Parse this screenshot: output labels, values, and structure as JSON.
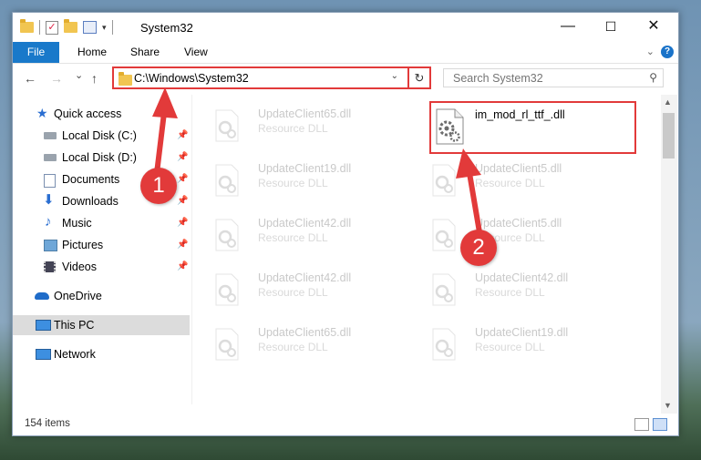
{
  "window": {
    "title": "System32",
    "controls": {
      "minimize": "—",
      "maximize": "☐",
      "close": "✕"
    }
  },
  "ribbon": {
    "tabs": [
      "File",
      "Home",
      "Share",
      "View"
    ],
    "expand_icon": "chevron-down-icon",
    "help_icon": "help-icon"
  },
  "navbar": {
    "back": "←",
    "forward": "→",
    "recent": "⌄",
    "up": "↑",
    "address": "C:\\Windows\\System32",
    "search_placeholder": "Search System32"
  },
  "navigation_pane": {
    "items": [
      {
        "label": "Quick access",
        "icon": "star-icon"
      },
      {
        "label": "Local Disk (C:)",
        "icon": "drive-icon",
        "pinned": true
      },
      {
        "label": "Local Disk (D:)",
        "icon": "drive-icon",
        "pinned": true
      },
      {
        "label": "Documents",
        "icon": "documents-icon",
        "pinned": true
      },
      {
        "label": "Downloads",
        "icon": "downloads-icon",
        "pinned": true
      },
      {
        "label": "Music",
        "icon": "music-icon",
        "pinned": true
      },
      {
        "label": "Pictures",
        "icon": "pictures-icon",
        "pinned": true
      },
      {
        "label": "Videos",
        "icon": "videos-icon",
        "pinned": true
      },
      {
        "label": "OneDrive",
        "icon": "cloud-icon"
      },
      {
        "label": "This PC",
        "icon": "computer-icon",
        "selected": true
      },
      {
        "label": "Network",
        "icon": "network-icon"
      }
    ]
  },
  "files": [
    {
      "name": "UpdateClient65.dll",
      "type": "Resource DLL"
    },
    {
      "name": "UpdateClient19.dll",
      "type": "Resource DLL"
    },
    {
      "name": "UpdateClient42.dll",
      "type": "Resource DLL"
    },
    {
      "name": "UpdateClient42.dll",
      "type": "Resource DLL"
    },
    {
      "name": "UpdateClient65.dll",
      "type": "Resource DLL"
    },
    {
      "name": "UpdateClient5.dll",
      "type": "Resource DLL"
    },
    {
      "name": "UpdateClient5.dll",
      "type": "Resource DLL"
    },
    {
      "name": "UpdateClient42.dll",
      "type": "Resource DLL"
    },
    {
      "name": "UpdateClient19.dll",
      "type": "Resource DLL"
    }
  ],
  "highlighted_file": {
    "name": "im_mod_rl_ttf_.dll"
  },
  "status": {
    "item_count": "154 items"
  },
  "annotations": {
    "step1": "1",
    "step2": "2"
  },
  "colors": {
    "accent": "#1979ca",
    "highlight": "#e23a3a"
  }
}
